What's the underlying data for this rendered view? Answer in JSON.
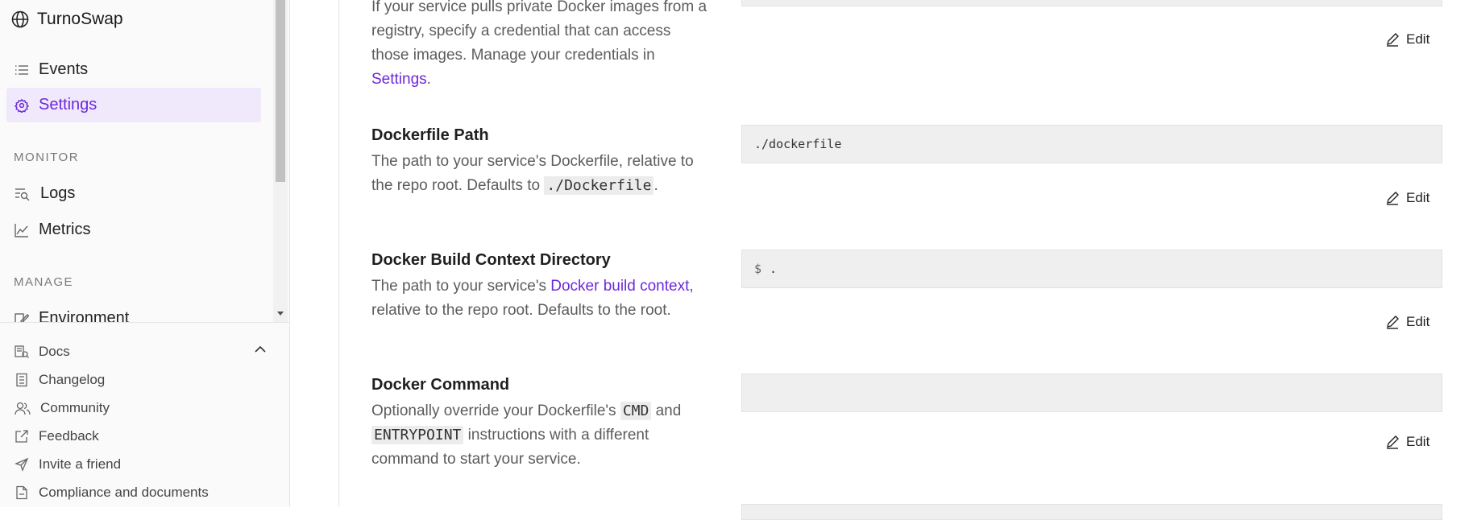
{
  "app": {
    "name": "TurnoSwap"
  },
  "sidebar": {
    "nav": [
      {
        "label": "Events",
        "icon": "list-icon"
      },
      {
        "label": "Settings",
        "icon": "gear-icon",
        "active": true
      }
    ],
    "monitor": {
      "label": "MONITOR",
      "items": [
        {
          "label": "Logs",
          "icon": "logs-search-icon"
        },
        {
          "label": "Metrics",
          "icon": "chart-icon"
        }
      ]
    },
    "manage": {
      "label": "MANAGE",
      "items": [
        {
          "label": "Environment",
          "icon": "environment-icon"
        }
      ]
    },
    "footer": [
      {
        "label": "Docs",
        "icon": "docs-icon"
      },
      {
        "label": "Changelog",
        "icon": "changelog-icon"
      },
      {
        "label": "Community",
        "icon": "community-icon"
      },
      {
        "label": "Feedback",
        "icon": "external-link-icon"
      },
      {
        "label": "Invite a friend",
        "icon": "send-icon"
      },
      {
        "label": "Compliance and documents",
        "icon": "document-icon"
      }
    ]
  },
  "sections": {
    "registry": {
      "desc_pre": "If your service pulls private Docker images from a registry, specify a credential that can access those images. Manage your credentials in",
      "link": "Settings",
      "desc_post": ".",
      "edit_label": "Edit"
    },
    "dockerfile": {
      "title": "Dockerfile Path",
      "desc_pre": "The path to your service's Dockerfile, relative to the repo root. Defaults to",
      "code": "./Dockerfile",
      "desc_post": ".",
      "value": "./dockerfile",
      "edit_label": "Edit"
    },
    "context": {
      "title": "Docker Build Context Directory",
      "desc_pre": "The path to your service's",
      "link": "Docker build context",
      "desc_post": ", relative to the repo root. Defaults to the root.",
      "prefix": "$",
      "value": ".",
      "edit_label": "Edit"
    },
    "command": {
      "title": "Docker Command",
      "desc_pre": "Optionally override your Dockerfile's",
      "code1": "CMD",
      "desc_mid": "and",
      "code2": "ENTRYPOINT",
      "desc_post": "instructions with a different command to start your service.",
      "value": "",
      "edit_label": "Edit"
    }
  },
  "colors": {
    "accent": "#6d28d9",
    "active_bg": "#efe9fb",
    "field_bg": "#efefef"
  }
}
